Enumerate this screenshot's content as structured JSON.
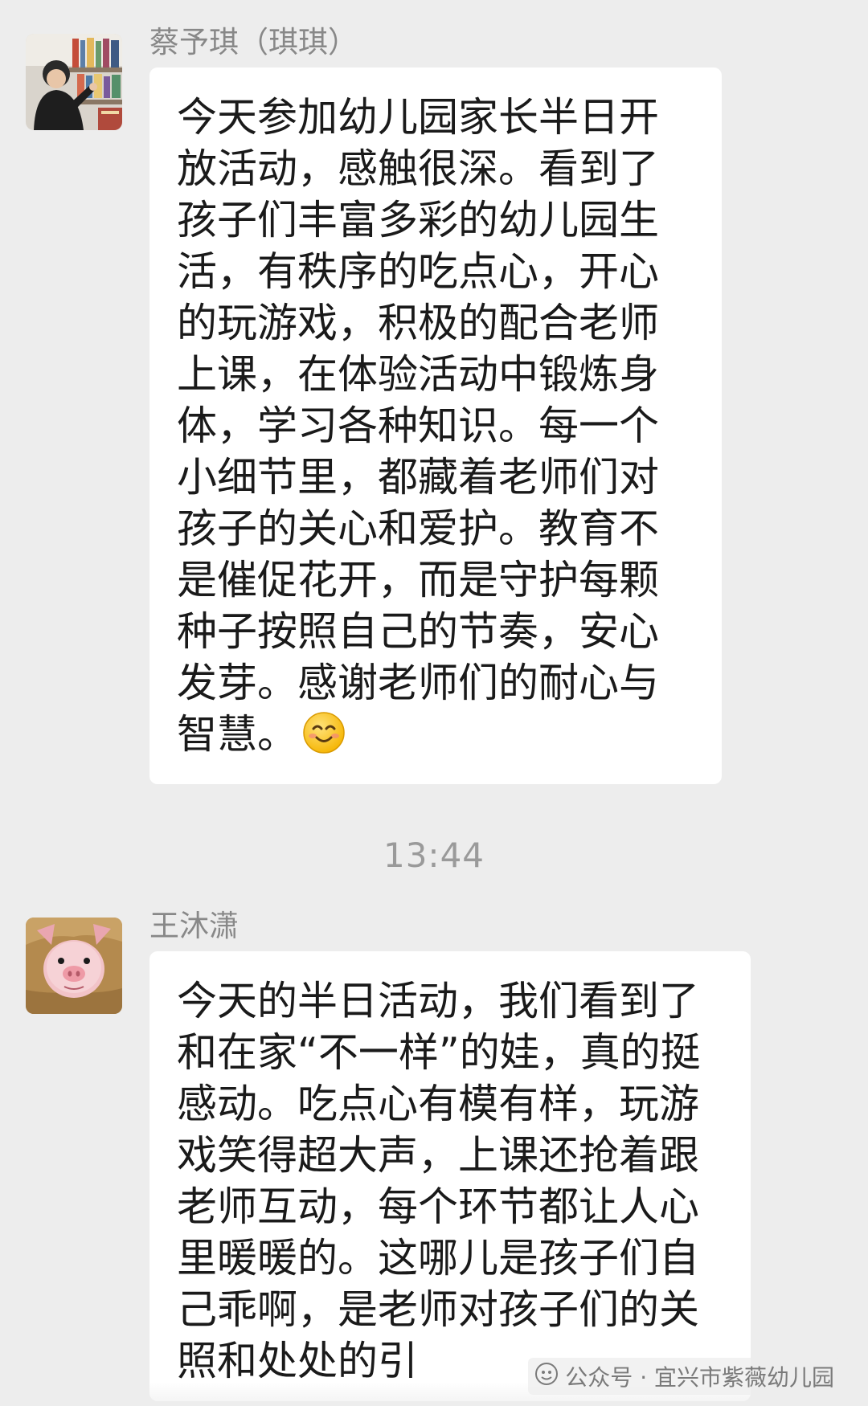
{
  "messages": [
    {
      "sender": "蔡予琪（琪琪）",
      "text": "今天参加幼儿园家长半日开放活动，感触很深。看到了孩子们丰富多彩的幼儿园生活，有秩序的吃点心，开心的玩游戏，积极的配合老师上课，在体验活动中锻炼身体，学习各种知识。每一个小细节里，都藏着老师们对孩子的关心和爱护。教育不是催促花开，而是守护每颗种子按照自己的节奏，安心发芽。感谢老师们的耐心与智慧。",
      "emoji": "smiling-face-emoji"
    },
    {
      "sender": "王沐潇",
      "text": "今天的半日活动，我们看到了和在家“不一样”的娃，真的挺感动。吃点心有模有样，玩游戏笑得超大声，上课还抢着跟老师互动，每个环节都让人心里暖暖的。这哪儿是孩子们自己乖啊，是老师对孩子们的关照和处处的引"
    }
  ],
  "timestamp": "13:44",
  "watermark": {
    "text": "公众号 · 宜兴市紫薇幼儿园",
    "icon": "wechat-official-account-icon"
  },
  "colors": {
    "background": "#ededed",
    "bubble": "#ffffff",
    "sender": "#888888",
    "timestamp": "#9a9a9a",
    "text": "#1a1a1a"
  }
}
